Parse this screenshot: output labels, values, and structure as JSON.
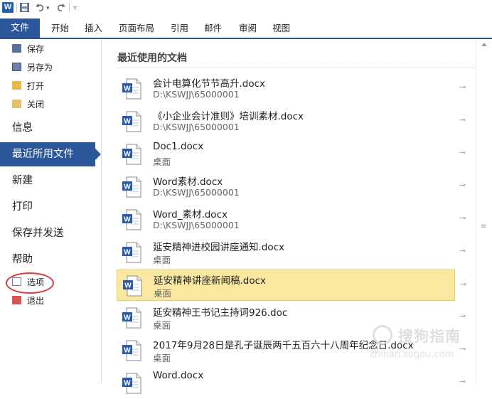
{
  "qat": {
    "app_icon": "word-icon",
    "app_letter": "W",
    "save_icon": "save-icon",
    "undo_icon": "undo-icon",
    "undo_dropdown": "▾",
    "redo_icon": "redo-icon",
    "customize": "▿"
  },
  "ribbon": {
    "file_tab": "文件",
    "tabs": [
      "开始",
      "插入",
      "页面布局",
      "引用",
      "邮件",
      "审阅",
      "视图"
    ]
  },
  "nav": {
    "small_top": [
      {
        "label": "保存",
        "icon": "save-icon"
      },
      {
        "label": "另存为",
        "icon": "save-as-icon"
      },
      {
        "label": "打开",
        "icon": "open-folder-icon"
      },
      {
        "label": "关闭",
        "icon": "close-folder-icon"
      }
    ],
    "info": "信息",
    "recent": "最近所用文件",
    "new": "新建",
    "print": "打印",
    "save_send": "保存并发送",
    "help": "帮助",
    "small_bottom": [
      {
        "label": "选项",
        "icon": "options-icon"
      },
      {
        "label": "退出",
        "icon": "exit-icon"
      }
    ]
  },
  "content": {
    "heading": "最近使用的文档",
    "pin_glyph": "⊸",
    "documents": [
      {
        "name": "会计电算化节节高升.docx",
        "path": "D:\\KSWJJ\\65000001",
        "selected": false
      },
      {
        "name": "《小企业会计准则》培训素材.docx",
        "path": "D:\\KSWJJ\\65000001",
        "selected": false
      },
      {
        "name": "Doc1.docx",
        "path": "桌面",
        "selected": false
      },
      {
        "name": "Word素材.docx",
        "path": "D:\\KSWJJ\\65000001",
        "selected": false
      },
      {
        "name": "Word_素材.docx",
        "path": "D:\\KSWJJ\\65000001",
        "selected": false
      },
      {
        "name": "延安精神进校园讲座通知.docx",
        "path": "桌面",
        "selected": false
      },
      {
        "name": "延安精神讲座新闻稿.docx",
        "path": "桌面",
        "selected": true
      },
      {
        "name": "延安精神王书记主持词926.doc",
        "path": "桌面",
        "selected": false
      },
      {
        "name": "2017年9月28日是孔子诞辰两千五百六十八周年纪念日.docx",
        "path": "桌面",
        "selected": false
      },
      {
        "name": "Word.docx",
        "path": "",
        "selected": false
      }
    ]
  },
  "scrollbar": {
    "grip": "≡"
  },
  "watermark": {
    "brand": "搜狗指南",
    "url": "zhinan.sogou.com"
  },
  "colors": {
    "accent": "#2b579a",
    "selected_row": "#fbe8a0",
    "highlight_circle": "#d93a3a"
  }
}
